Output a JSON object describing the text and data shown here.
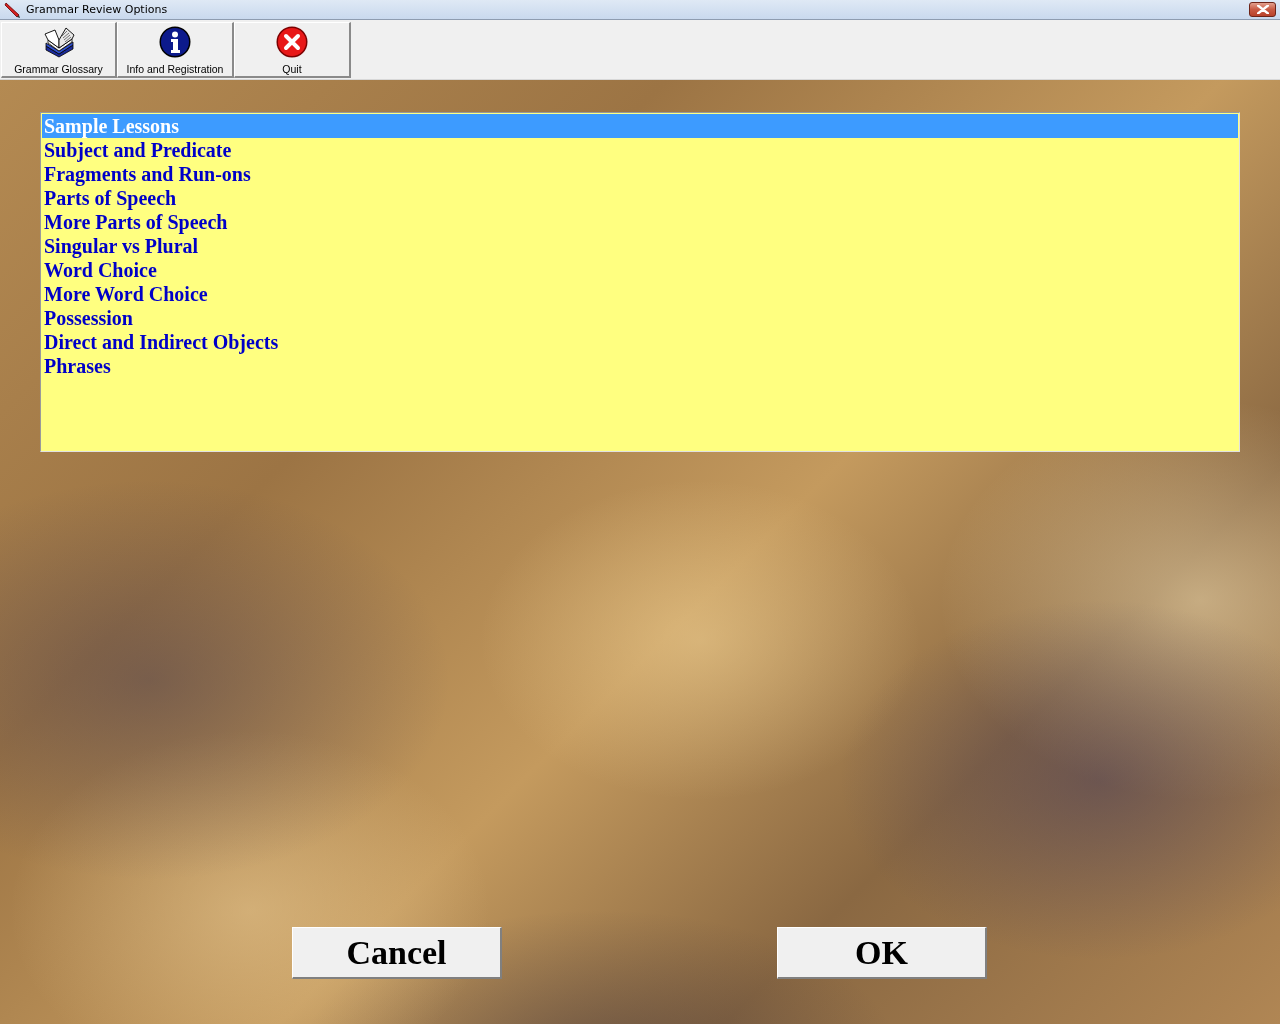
{
  "window": {
    "title": "Grammar Review Options"
  },
  "toolbar": [
    {
      "kind": "book",
      "label": "Grammar Glossary"
    },
    {
      "kind": "info",
      "label": "Info and Registration"
    },
    {
      "kind": "quit",
      "label": "Quit"
    }
  ],
  "lessons": [
    {
      "label": "Sample Lessons",
      "selected": true
    },
    {
      "label": "Subject and Predicate",
      "selected": false
    },
    {
      "label": "Fragments and Run-ons",
      "selected": false
    },
    {
      "label": "Parts of Speech",
      "selected": false
    },
    {
      "label": "More Parts of Speech",
      "selected": false
    },
    {
      "label": "Singular vs Plural",
      "selected": false
    },
    {
      "label": "Word Choice",
      "selected": false
    },
    {
      "label": "More Word Choice",
      "selected": false
    },
    {
      "label": "Possession",
      "selected": false
    },
    {
      "label": "Direct and Indirect Objects",
      "selected": false
    },
    {
      "label": "Phrases",
      "selected": false
    }
  ],
  "buttons": [
    "Cancel",
    "OK"
  ]
}
